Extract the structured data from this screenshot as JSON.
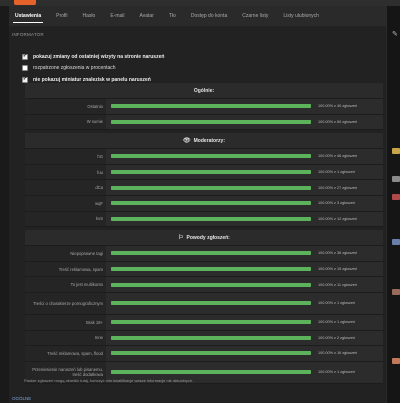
{
  "tabs": [
    "Ustawienia",
    "Profil",
    "Hasło",
    "E-mail",
    "Avatar",
    "Tło",
    "Dostęp do konta",
    "Czarne listy",
    "Listy ulubionych"
  ],
  "section_label": "INFORMATOR",
  "options": [
    {
      "label": "pokazuj zmiany od ostatniej wizyty na stronie naruszeń",
      "checked": true,
      "bold": true
    },
    {
      "label": "rozpatrzone zgłoszenia w procentach",
      "checked": false,
      "bold": false
    },
    {
      "label": "nie pokazuj miniatur znalezisk w panelu naruszeń",
      "checked": true,
      "bold": true
    }
  ],
  "general": {
    "title": "Ogólnie:",
    "rows": [
      {
        "label": "Ostatnio",
        "value": 100.0,
        "text": "100.00% z 40 zgłoszeń"
      },
      {
        "label": "W sumie",
        "value": 100.0,
        "text": "100.00% z 60 zgłoszeń"
      }
    ]
  },
  "moderators": {
    "title": "Moderatorzy:",
    "icon": "eye-icon",
    "rows": [
      {
        "label": "hG",
        "value": 100.0,
        "text": "100.00% z 46 zgłoszeń"
      },
      {
        "label": "fuu",
        "value": 100.0,
        "text": "100.00% z 1 zgłoszeń"
      },
      {
        "label": "dCa",
        "value": 100.0,
        "text": "100.00% z 27 zgłoszeń"
      },
      {
        "label": "wqF",
        "value": 100.0,
        "text": "100.00% z 3 zgłoszeń"
      },
      {
        "label": "kvS",
        "value": 100.0,
        "text": "100.00% z 12 zgłoszeń"
      }
    ]
  },
  "reasons": {
    "title": "Powody zgłoszeń:",
    "icon": "flag-icon",
    "rows": [
      {
        "label": "Niepoprawne tagi",
        "value": 100.0,
        "text": "100.00% z 36 zgłoszeń"
      },
      {
        "label": "Treść reklamowa, spam",
        "value": 100.0,
        "text": "100.00% z 15 zgłoszeń"
      },
      {
        "label": "To jest multikonto",
        "value": 100.0,
        "text": "100.00% z 11 zgłoszeń"
      },
      {
        "label": "Treści o charakterze pornograficznym",
        "value": 100.0,
        "text": "100.00% z 1 zgłoszeń"
      },
      {
        "label": "Brak 18+",
        "value": 100.0,
        "text": "100.00% z 1 zgłoszeń"
      },
      {
        "label": "Inne",
        "value": 100.0,
        "text": "100.00% z 2 zgłoszeń"
      },
      {
        "label": "Treść reklamowa, spam, flood",
        "value": 100.0,
        "text": "100.00% z 16 zgłoszeń"
      },
      {
        "label": "Przeniesienie naruszeń lub pisanemu, treść dodatkowa",
        "value": 100.0,
        "text": "100.00% z 1 zgłoszeń"
      }
    ]
  },
  "footnote": "Pasker zgłoszeń mogą określić tutaj, kończyć nim kwalifikacje wasze informacje nie aktualnych.",
  "bottom_link": "OGÓLNE",
  "colors": {
    "bar": "#5cb35c",
    "accent": "#e5632a",
    "background": "#1a1a1a"
  }
}
